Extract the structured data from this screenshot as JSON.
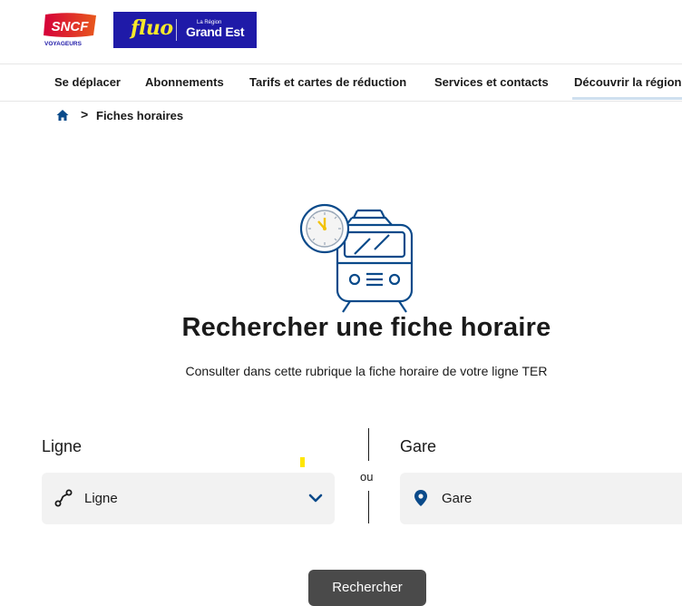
{
  "header": {
    "sncf_logo": "SNCF",
    "sncf_sub": "VOYAGEURS",
    "fluo_logo": "fluo",
    "region_small": "La Région",
    "region_big": "Grand Est"
  },
  "nav": {
    "items": [
      {
        "label": "Se déplacer"
      },
      {
        "label": "Abonnements"
      },
      {
        "label": "Tarifs et cartes de réduction"
      },
      {
        "label": "Services et contacts"
      },
      {
        "label": "Découvrir la région"
      }
    ]
  },
  "breadcrumb": {
    "home_icon": "home-icon",
    "separator": ">",
    "current": "Fiches horaires"
  },
  "main": {
    "title": "Rechercher une fiche horaire",
    "subtitle": "Consulter dans cette rubrique la fiche horaire de votre ligne TER"
  },
  "form": {
    "ligne_label": "Ligne",
    "ligne_placeholder": "Ligne",
    "or_label": "ou",
    "gare_label": "Gare",
    "gare_placeholder": "Gare",
    "search_button": "Rechercher"
  },
  "colors": {
    "accent": "#0a4a8a",
    "brand_fluo": "#1f1aa8",
    "sncf_red": "#d5003a",
    "button": "#4a4a4a"
  }
}
